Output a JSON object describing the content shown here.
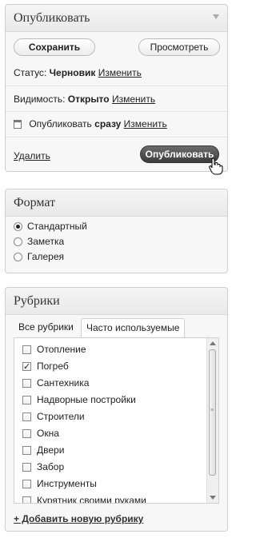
{
  "publish": {
    "title": "Опубликовать",
    "save_label": "Сохранить",
    "preview_label": "Просмотреть",
    "status_label": "Статус:",
    "status_value": "Черновик",
    "status_edit": "Изменить",
    "visibility_label": "Видимость:",
    "visibility_value": "Открыто",
    "visibility_edit": "Изменить",
    "publish_when_label": "Опубликовать",
    "publish_when_value": "сразу",
    "publish_when_edit": "Изменить",
    "delete_label": "Удалить",
    "publish_label": "Опубликовать"
  },
  "format": {
    "title": "Формат",
    "options": [
      {
        "label": "Стандартный",
        "selected": true
      },
      {
        "label": "Заметка",
        "selected": false
      },
      {
        "label": "Галерея",
        "selected": false
      }
    ]
  },
  "categories": {
    "title": "Рубрики",
    "tabs": [
      "Все рубрики",
      "Часто используемые"
    ],
    "active_tab": 1,
    "items": [
      {
        "label": "Отопление",
        "checked": false
      },
      {
        "label": "Погреб",
        "checked": true
      },
      {
        "label": "Сантехника",
        "checked": false
      },
      {
        "label": "Надворные постройки",
        "checked": false
      },
      {
        "label": "Строители",
        "checked": false
      },
      {
        "label": "Окна",
        "checked": false
      },
      {
        "label": "Двери",
        "checked": false
      },
      {
        "label": "Забор",
        "checked": false
      },
      {
        "label": "Инструменты",
        "checked": false
      },
      {
        "label": "Курятник своими руками",
        "checked": false
      }
    ],
    "add_new_label": "+ Добавить новую рубрику"
  }
}
